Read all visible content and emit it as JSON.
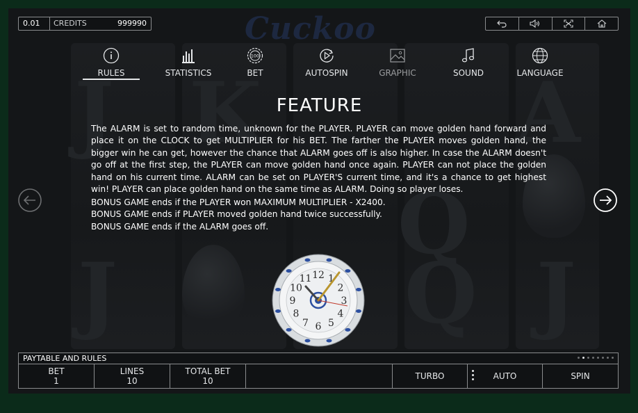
{
  "top_bar": {
    "bet": "0.01",
    "credits_label": "CREDITS",
    "credits_value": "999990",
    "logo_text": "Cuckoo",
    "tools": [
      "back-icon",
      "sound-icon",
      "fullscreen-icon",
      "home-icon"
    ]
  },
  "tabs": [
    {
      "label": "RULES",
      "icon": "info-icon",
      "active": true
    },
    {
      "label": "STATISTICS",
      "icon": "bar-chart-icon"
    },
    {
      "label": "BET",
      "icon": "chip-icon",
      "icon_text": "100"
    },
    {
      "label": "AUTOSPIN",
      "icon": "autospin-icon"
    },
    {
      "label": "GRAPHIC",
      "icon": "image-icon",
      "dim": true
    },
    {
      "label": "SOUND",
      "icon": "music-icon"
    },
    {
      "label": "LANGUAGE",
      "icon": "globe-icon"
    }
  ],
  "feature": {
    "title": "FEATURE",
    "paragraph": "The ALARM is set to random time, unknown for the PLAYER. PLAYER can move golden hand forward and place it on the CLOCK to get MULTIPLIER for his BET. The farther the PLAYER moves golden hand, the bigger win he can get, however the chance that ALARM goes off is also higher. In case the ALARM doesn't go off at the first step, the PLAYER can move golden hand once again. PLAYER can not place the golden hand on his current time. ALARM can be set on PLAYER'S current time, and it's a chance to get highest win! PLAYER can place golden hand on the same time as ALARM. Doing so player loses.",
    "bonus_lines": [
      "BONUS GAME ends if the PLAYER won MAXIMUM MULTIPLIER - X2400.",
      "BONUS GAME ends if PLAYER moved golden hand twice successfully.",
      "BONUS GAME ends if the ALARM goes off."
    ]
  },
  "clock": {
    "numbers": [
      "12",
      "1",
      "2",
      "3",
      "4",
      "5",
      "6",
      "7",
      "8",
      "9",
      "10",
      "11"
    ]
  },
  "bottom": {
    "section_label": "PAYTABLE AND RULES",
    "page_count": 8,
    "active_page": 1,
    "bet_label": "BET",
    "bet_value": "1",
    "lines_label": "LINES",
    "lines_value": "10",
    "total_label": "TOTAL BET",
    "total_value": "10",
    "turbo_label": "TURBO",
    "auto_label": "AUTO",
    "spin_label": "SPIN"
  },
  "colors": {
    "background": "#141618",
    "frame": "#0b2b1a",
    "text": "#ffffff",
    "border": "#8a8c8e"
  }
}
